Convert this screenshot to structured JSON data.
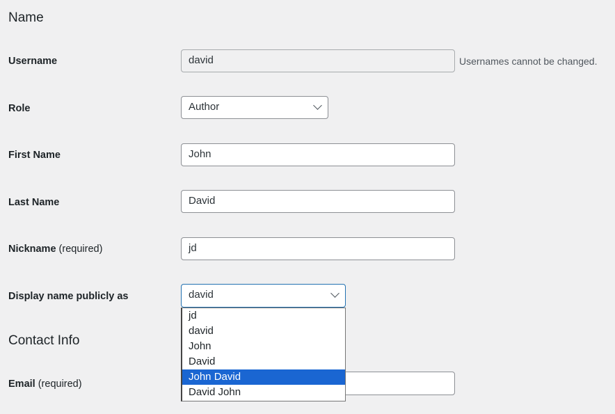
{
  "sections": {
    "name": "Name",
    "contact": "Contact Info"
  },
  "username": {
    "label": "Username",
    "value": "david",
    "description": "Usernames cannot be changed."
  },
  "role": {
    "label": "Role",
    "value": "Author"
  },
  "first_name": {
    "label": "First Name",
    "value": "John"
  },
  "last_name": {
    "label": "Last Name",
    "value": "David"
  },
  "nickname": {
    "label": "Nickname",
    "required": "(required)",
    "value": "jd"
  },
  "display_name": {
    "label": "Display name publicly as",
    "value": "david",
    "options": [
      "jd",
      "david",
      "John",
      "David",
      "John David",
      "David John"
    ],
    "highlighted": "John David"
  },
  "email": {
    "label": "Email",
    "required": "(required)",
    "value": ""
  },
  "colors": {
    "highlight": "#1a66d2",
    "focus": "#2271b1"
  }
}
